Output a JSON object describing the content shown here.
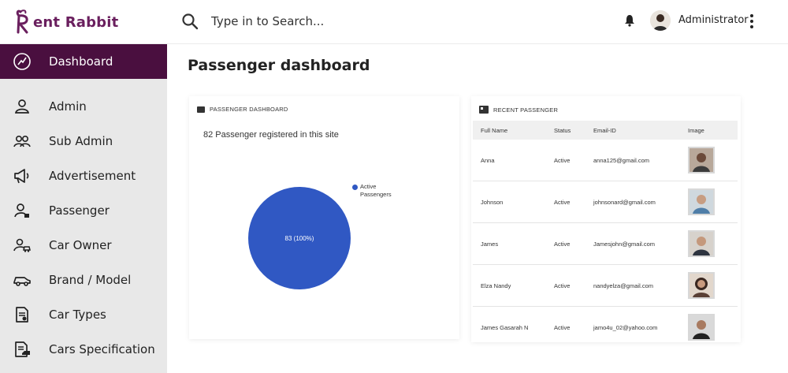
{
  "app": {
    "logo_text": "ent Rabbit",
    "brand_color": "#6a1f5e",
    "accent_color": "#4a0f3f"
  },
  "search": {
    "placeholder": "Type in to Search...",
    "icon": "search-icon"
  },
  "user": {
    "name": "Administrator"
  },
  "sidebar": {
    "items": [
      {
        "label": "Dashboard",
        "icon": "dashboard-icon",
        "active": true
      },
      {
        "label": "Admin",
        "icon": "user-icon"
      },
      {
        "label": "Sub Admin",
        "icon": "users-icon"
      },
      {
        "label": "Advertisement",
        "icon": "megaphone-icon"
      },
      {
        "label": "Passenger",
        "icon": "passenger-icon"
      },
      {
        "label": "Car Owner",
        "icon": "car-owner-icon"
      },
      {
        "label": "Brand / Model",
        "icon": "car-icon"
      },
      {
        "label": "Car Types",
        "icon": "document-icon"
      },
      {
        "label": "Cars Specification",
        "icon": "specification-icon"
      }
    ]
  },
  "main": {
    "title": "Passenger dashboard",
    "passenger_card": {
      "header": "PASSENGER DASHBOARD",
      "registered_text": "82 Passenger registered in this site",
      "chart_data": {
        "type": "pie",
        "slices": [
          {
            "name": "Active Passengers",
            "value": 83,
            "label": "83 (100%)",
            "color": "#3058c3"
          }
        ],
        "legend": [
          "Active Passengers"
        ],
        "legend_line1": "Active",
        "legend_line2": "Passengers",
        "legend_position": "top-right"
      }
    },
    "recent_card": {
      "header": "RECENT PASSENGER",
      "columns": [
        "Full Name",
        "Status",
        "Email-ID",
        "Image"
      ],
      "rows": [
        {
          "name": "Anna",
          "status": "Active",
          "email": "anna125@gmail.com"
        },
        {
          "name": "Johnson",
          "status": "Active",
          "email": "johnsonard@gmail.com"
        },
        {
          "name": "James",
          "status": "Active",
          "email": "Jamesjohn@gmail.com"
        },
        {
          "name": "Elza Nandy",
          "status": "Active",
          "email": "nandyelza@gmail.com"
        },
        {
          "name": "James Gasarah N",
          "status": "Active",
          "email": "jamo4u_02@yahoo.com"
        }
      ]
    }
  }
}
